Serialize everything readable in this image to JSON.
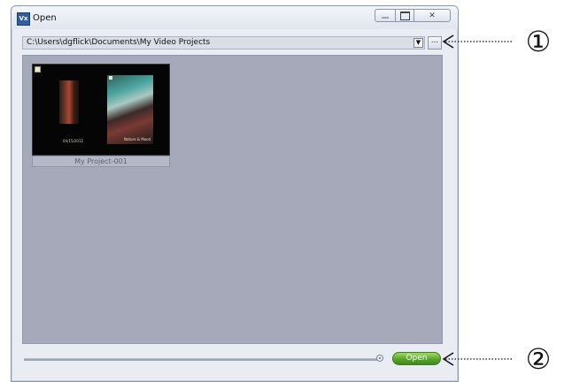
{
  "window": {
    "title": "Open",
    "app_icon_text": "Vx"
  },
  "path_bar": {
    "path": "C:\\Users\\dgflick\\Documents\\My Video Projects",
    "dropdown_glyph": "▼",
    "browse_label": "..."
  },
  "projects": [
    {
      "name": "My Project-001",
      "thumb_caption_left": "04/15/2012",
      "thumb_caption_right": "Nature & Mood"
    }
  ],
  "bottom_bar": {
    "open_label": "Open"
  },
  "annotations": {
    "callout_1": "①",
    "callout_2": "②"
  },
  "icons": {
    "minimize": "minimize-icon",
    "maximize": "maximize-icon",
    "close": "close-icon",
    "dropdown": "chevron-down-icon"
  },
  "colors": {
    "gallery_bg": "#a6a9ba",
    "open_button": "#5aa42a"
  }
}
